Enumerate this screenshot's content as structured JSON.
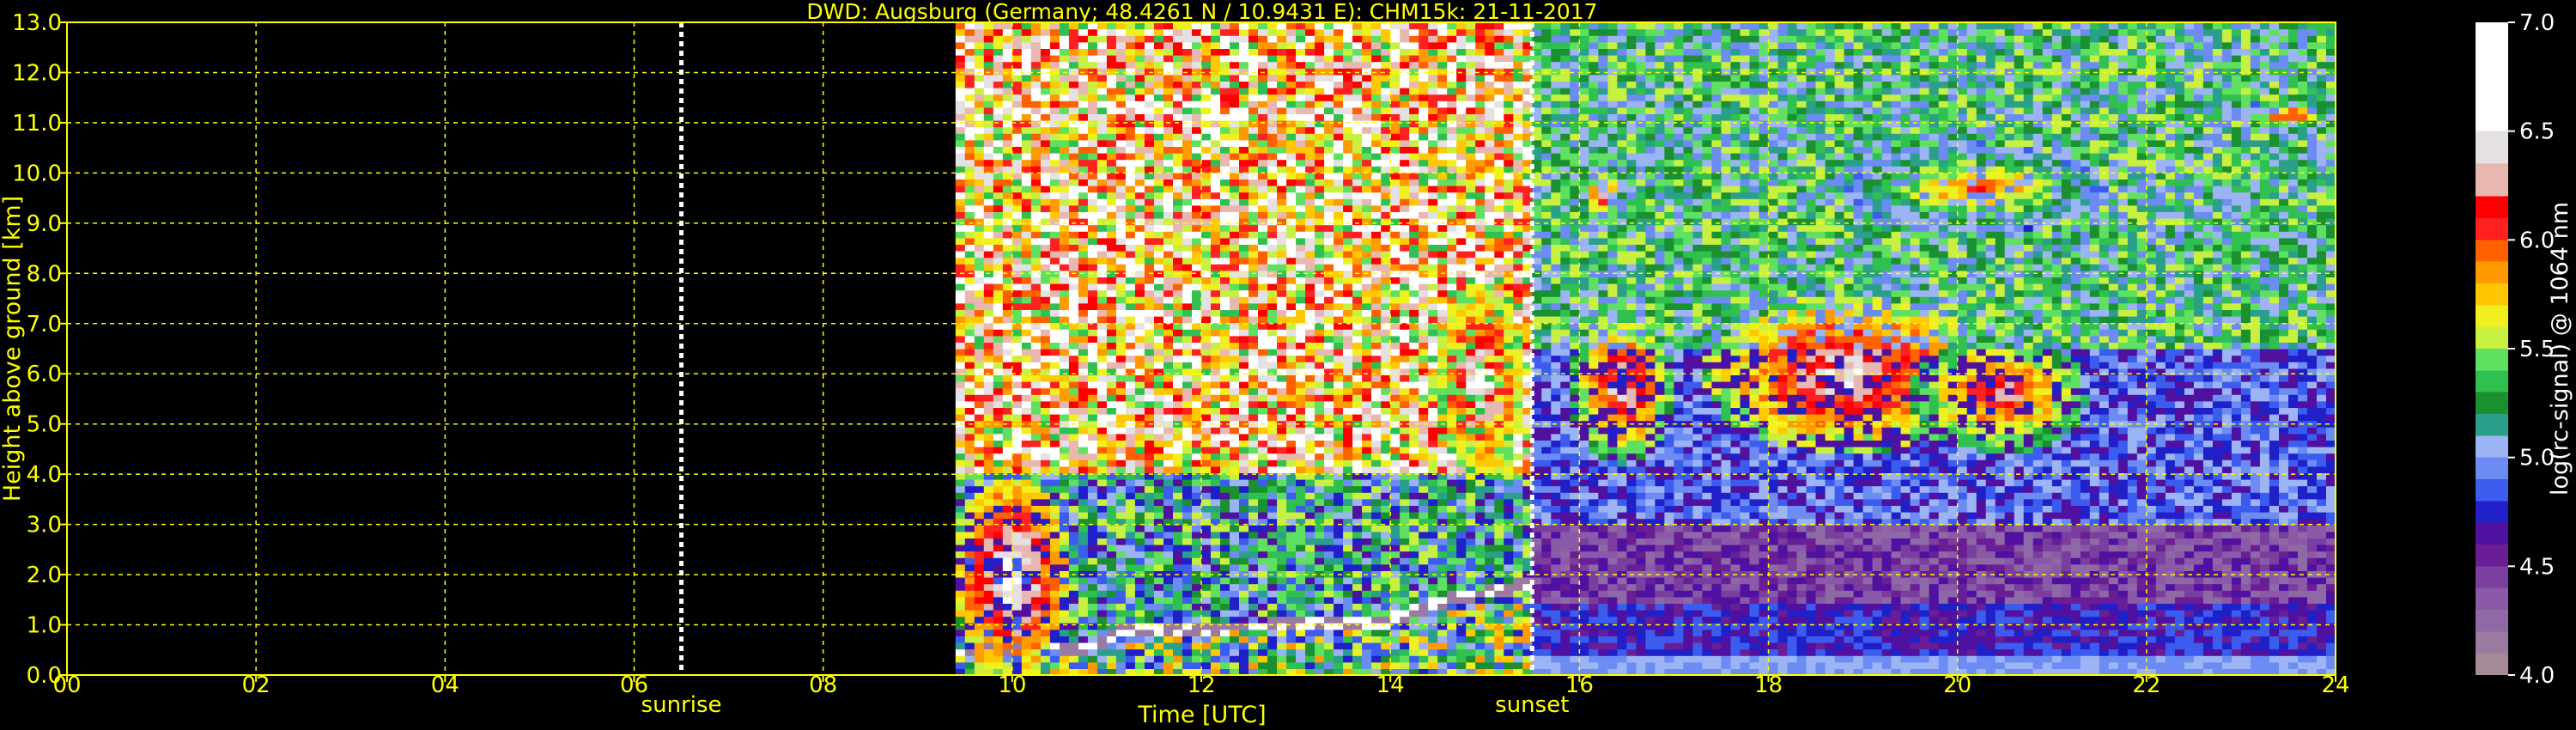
{
  "chart_data": {
    "type": "heatmap",
    "title": "DWD: Augsburg (Germany; 48.4261 N / 10.9431 E):    CHM15k: 21-11-2017",
    "xlabel": "Time [UTC]",
    "ylabel": "Height above ground [km]",
    "xlim": [
      0,
      24
    ],
    "ylim": [
      0,
      13
    ],
    "x_ticks": [
      "00",
      "02",
      "04",
      "06",
      "08",
      "10",
      "12",
      "14",
      "16",
      "18",
      "20",
      "22",
      "24"
    ],
    "x_tick_values": [
      0,
      2,
      4,
      6,
      8,
      10,
      12,
      14,
      16,
      18,
      20,
      22,
      24
    ],
    "y_ticks": [
      "0.0",
      "1.0",
      "2.0",
      "3.0",
      "4.0",
      "5.0",
      "6.0",
      "7.0",
      "8.0",
      "9.0",
      "10.0",
      "11.0",
      "12.0",
      "13.0"
    ],
    "y_tick_values": [
      0,
      1,
      2,
      3,
      4,
      5,
      6,
      7,
      8,
      9,
      10,
      11,
      12,
      13
    ],
    "grid": true,
    "data_start_hour": 9.4,
    "markers": [
      {
        "label": "sunrise",
        "hour": 6.5
      },
      {
        "label": "sunset",
        "hour": 15.5
      }
    ],
    "colorbar": {
      "label": "log(rc-signal) @ 1064 nm",
      "range": [
        4.0,
        7.0
      ],
      "ticks": [
        "4.0",
        "4.5",
        "5.0",
        "5.5",
        "6.0",
        "6.5",
        "7.0"
      ],
      "tick_values": [
        4.0,
        4.5,
        5.0,
        5.5,
        6.0,
        6.5,
        7.0
      ],
      "stops": [
        {
          "v": 4.0,
          "c": "#a58a9a"
        },
        {
          "v": 4.1,
          "c": "#9a7aa0"
        },
        {
          "v": 4.2,
          "c": "#8f68a6"
        },
        {
          "v": 4.3,
          "c": "#8a5aa8"
        },
        {
          "v": 4.4,
          "c": "#7a3e9e"
        },
        {
          "v": 4.5,
          "c": "#6a1e96"
        },
        {
          "v": 4.6,
          "c": "#5010a0"
        },
        {
          "v": 4.7,
          "c": "#2020c8"
        },
        {
          "v": 4.8,
          "c": "#3c5cf0"
        },
        {
          "v": 4.9,
          "c": "#6c8cf4"
        },
        {
          "v": 5.0,
          "c": "#9cb4f4"
        },
        {
          "v": 5.1,
          "c": "#2aa08a"
        },
        {
          "v": 5.2,
          "c": "#1a9030"
        },
        {
          "v": 5.3,
          "c": "#30c050"
        },
        {
          "v": 5.4,
          "c": "#60e060"
        },
        {
          "v": 5.5,
          "c": "#c8f040"
        },
        {
          "v": 5.6,
          "c": "#f0f020"
        },
        {
          "v": 5.7,
          "c": "#ffc800"
        },
        {
          "v": 5.8,
          "c": "#ff9a00"
        },
        {
          "v": 5.9,
          "c": "#ff6000"
        },
        {
          "v": 6.0,
          "c": "#ff2020"
        },
        {
          "v": 6.1,
          "c": "#ff0000"
        },
        {
          "v": 6.2,
          "c": "#e8b8b0"
        },
        {
          "v": 6.35,
          "c": "#e4e0e4"
        },
        {
          "v": 6.5,
          "c": "#ffffff"
        },
        {
          "v": 7.0,
          "c": "#ffffff"
        }
      ]
    },
    "features": [
      {
        "name": "boundary-layer-top",
        "points": [
          [
            9.6,
            0.45
          ],
          [
            10.2,
            0.6
          ],
          [
            10.8,
            0.55
          ],
          [
            11.2,
            0.9
          ],
          [
            12.0,
            0.95
          ],
          [
            13.0,
            1.0
          ],
          [
            14.0,
            1.1
          ],
          [
            14.6,
            1.5
          ],
          [
            15.2,
            1.7
          ],
          [
            16.0,
            2.1
          ]
        ],
        "value": 6.5
      },
      {
        "name": "low-cloud-morning",
        "bounds": [
          9.4,
          10.6,
          0.0,
          4.0
        ],
        "value": 6.4
      },
      {
        "name": "midlevel-cloud-1",
        "bounds": [
          14.5,
          15.4,
          3.9,
          7.8
        ],
        "value": 6.3
      },
      {
        "name": "midlevel-cloud-2",
        "bounds": [
          15.9,
          17.0,
          4.2,
          7.3
        ],
        "value": 6.1
      },
      {
        "name": "midlevel-cloud-3",
        "bounds": [
          17.3,
          20.4,
          4.4,
          7.6
        ],
        "value": 6.2
      },
      {
        "name": "midlevel-cloud-4",
        "bounds": [
          19.5,
          21.4,
          4.4,
          6.8
        ],
        "value": 6.0
      },
      {
        "name": "cirrus-1",
        "bounds": [
          16.0,
          16.5,
          8.9,
          10.2
        ],
        "value": 5.9
      },
      {
        "name": "cirrus-2",
        "bounds": [
          18.8,
          21.6,
          8.8,
          10.6
        ],
        "value": 5.7
      },
      {
        "name": "cirrus-3",
        "bounds": [
          23.0,
          24.0,
          10.8,
          11.5
        ],
        "value": 5.8
      },
      {
        "name": "evening-boundary-layer",
        "bounds": [
          15.5,
          24.0,
          0.0,
          1.6
        ],
        "value": 4.8
      }
    ]
  }
}
